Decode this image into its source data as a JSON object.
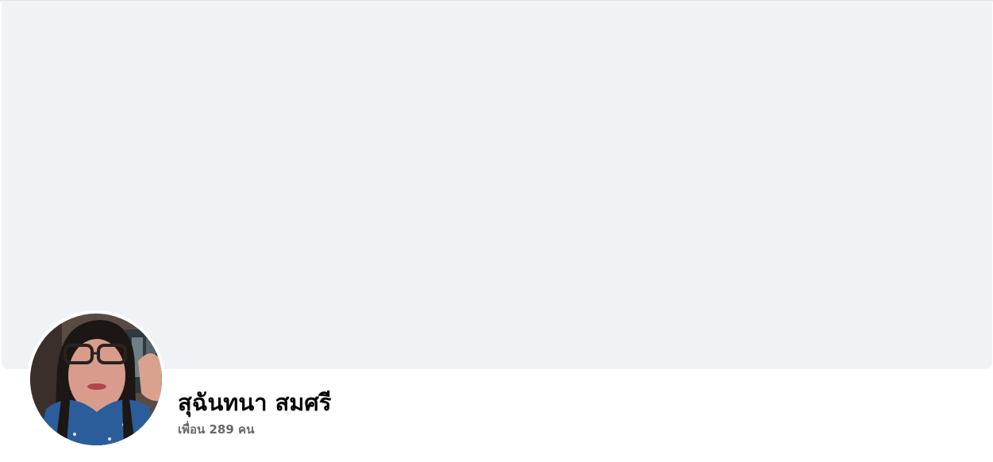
{
  "profile": {
    "name": "สุฉันทนา สมศรี",
    "friends_text": "เพื่อน 289 คน"
  },
  "colors": {
    "cover_background": "#f0f2f5",
    "name_text": "#050505",
    "secondary_text": "#65676b"
  }
}
